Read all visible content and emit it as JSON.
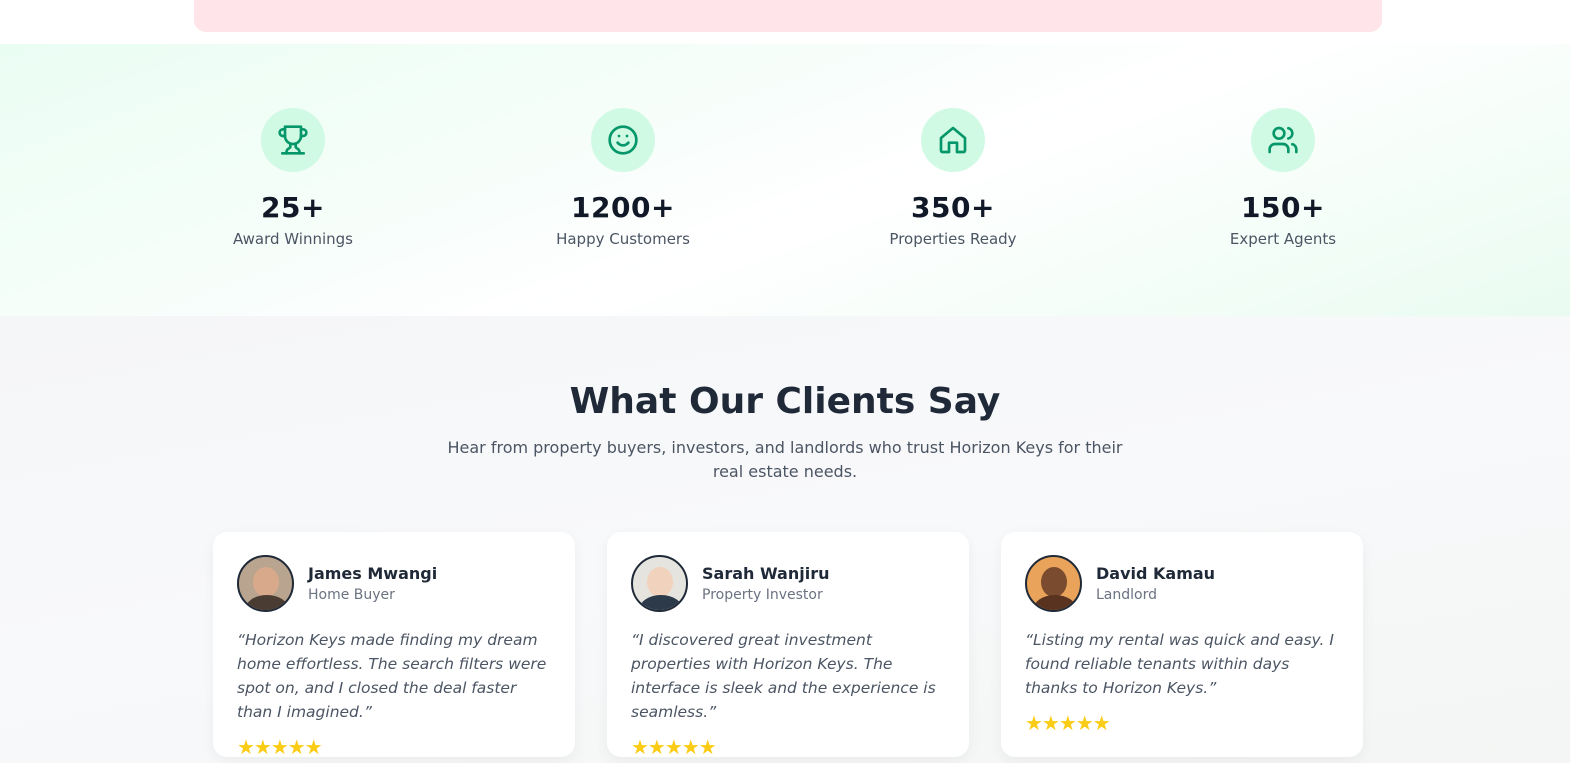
{
  "stats": [
    {
      "value": "25+",
      "label": "Award Winnings",
      "icon": "trophy-icon"
    },
    {
      "value": "1200+",
      "label": "Happy Customers",
      "icon": "smile-icon"
    },
    {
      "value": "350+",
      "label": "Properties Ready",
      "icon": "home-icon"
    },
    {
      "value": "150+",
      "label": "Expert Agents",
      "icon": "users-icon"
    }
  ],
  "testimonials_section": {
    "title": "What Our Clients Say",
    "subtitle": "Hear from property buyers, investors, and landlords who trust Horizon Keys for their real estate needs."
  },
  "testimonials": [
    {
      "name": "James Mwangi",
      "role": "Home Buyer",
      "quote": "“Horizon Keys made finding my dream home effortless. The search filters were spot on, and I closed the deal faster than I imagined.”",
      "rating": 5,
      "stars": "★★★★★"
    },
    {
      "name": "Sarah Wanjiru",
      "role": "Property Investor",
      "quote": "“I discovered great investment properties with Horizon Keys. The interface is sleek and the experience is seamless.”",
      "rating": 5,
      "stars": "★★★★★"
    },
    {
      "name": "David Kamau",
      "role": "Landlord",
      "quote": "“Listing my rental was quick and easy. I found reliable tenants within days thanks to Horizon Keys.”",
      "rating": 5,
      "stars": "★★★★★"
    }
  ],
  "colors": {
    "accent": "#059669",
    "icon_bg": "#d1fae5",
    "star": "#facc15",
    "banner": "#ffe4e9"
  }
}
